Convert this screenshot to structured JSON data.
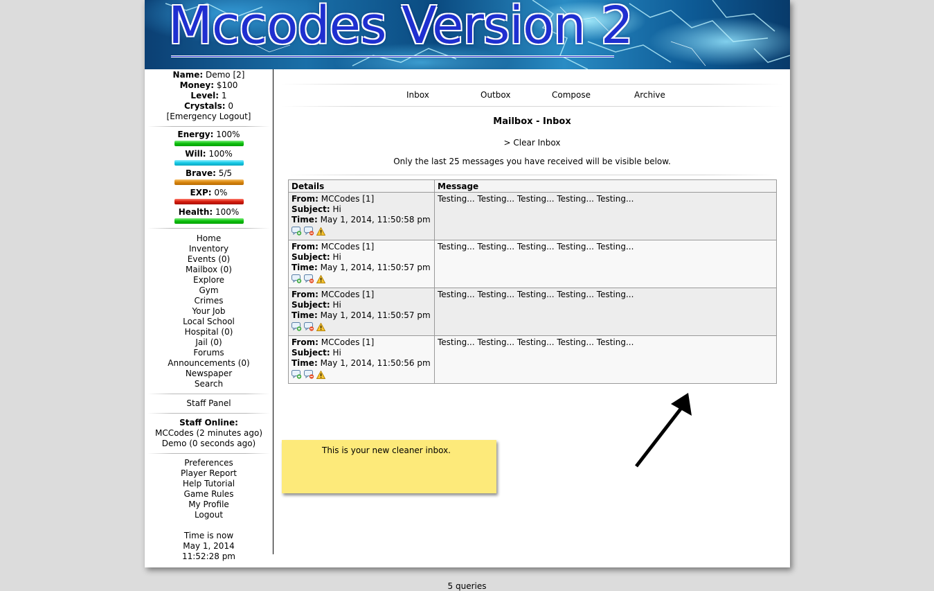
{
  "header": {
    "title": "Mccodes Version 2"
  },
  "sidebar": {
    "user": {
      "name_label": "Name:",
      "name_value": "Demo [2]",
      "money_label": "Money:",
      "money_value": "$100",
      "level_label": "Level:",
      "level_value": "1",
      "crystals_label": "Crystals:",
      "crystals_value": "0",
      "logout_link": "[Emergency Logout]"
    },
    "stats": {
      "energy_label": "Energy:",
      "energy_value": "100%",
      "energy_pct": 100,
      "energy_color": "#0dbf0d",
      "will_label": "Will:",
      "will_value": "100%",
      "will_pct": 100,
      "will_color": "#16c9e6",
      "brave_label": "Brave:",
      "brave_value": "5/5",
      "brave_pct": 100,
      "brave_color": "#d9850c",
      "exp_label": "EXP:",
      "exp_value": "0%",
      "exp_pct": 0,
      "exp_color": "#d41c0c",
      "health_label": "Health:",
      "health_value": "100%",
      "health_pct": 100,
      "health_color": "#0dbf0d"
    },
    "nav": [
      "Home",
      "Inventory",
      "Events (0)",
      "Mailbox (0)",
      "Explore",
      "Gym",
      "Crimes",
      "Your Job",
      "Local School",
      "Hospital (0)",
      "Jail (0)",
      "Forums",
      "Announcements (0)",
      "Newspaper",
      "Search"
    ],
    "staff_panel": "Staff Panel",
    "staff_online": {
      "label": "Staff Online:",
      "members": [
        "MCCodes (2 minutes ago)",
        "Demo (0 seconds ago)"
      ]
    },
    "bottom_nav": [
      "Preferences",
      "Player Report",
      "Help Tutorial",
      "Game Rules",
      "My Profile",
      "Logout"
    ],
    "time": {
      "line1": "Time is now",
      "line2": "May 1, 2014",
      "line3": "11:52:28 pm"
    }
  },
  "mailbox": {
    "tabs": [
      "Inbox",
      "Outbox",
      "Compose",
      "Archive"
    ],
    "title": "Mailbox - Inbox",
    "clear_inbox": "> Clear Inbox",
    "notice": "Only the last 25 messages you have received will be visible below.",
    "columns": [
      "Details",
      "Message"
    ],
    "labels": {
      "from": "From:",
      "subject": "Subject:",
      "time": "Time:"
    },
    "messages": [
      {
        "from": "MCCodes [1]",
        "subject": "Hi",
        "time": "May 1, 2014, 11:50:58 pm",
        "body": "Testing... Testing... Testing... Testing... Testing..."
      },
      {
        "from": "MCCodes [1]",
        "subject": "Hi",
        "time": "May 1, 2014, 11:50:57 pm",
        "body": "Testing... Testing... Testing... Testing... Testing..."
      },
      {
        "from": "MCCodes [1]",
        "subject": "Hi",
        "time": "May 1, 2014, 11:50:57 pm",
        "body": "Testing... Testing... Testing... Testing... Testing..."
      },
      {
        "from": "MCCodes [1]",
        "subject": "Hi",
        "time": "May 1, 2014, 11:50:56 pm",
        "body": "Testing... Testing... Testing... Testing... Testing..."
      }
    ],
    "row_icons": [
      "reply-icon",
      "delete-icon",
      "report-icon"
    ]
  },
  "annotation": {
    "note": "This is your new cleaner inbox."
  },
  "footer": {
    "queries": "5 queries"
  }
}
